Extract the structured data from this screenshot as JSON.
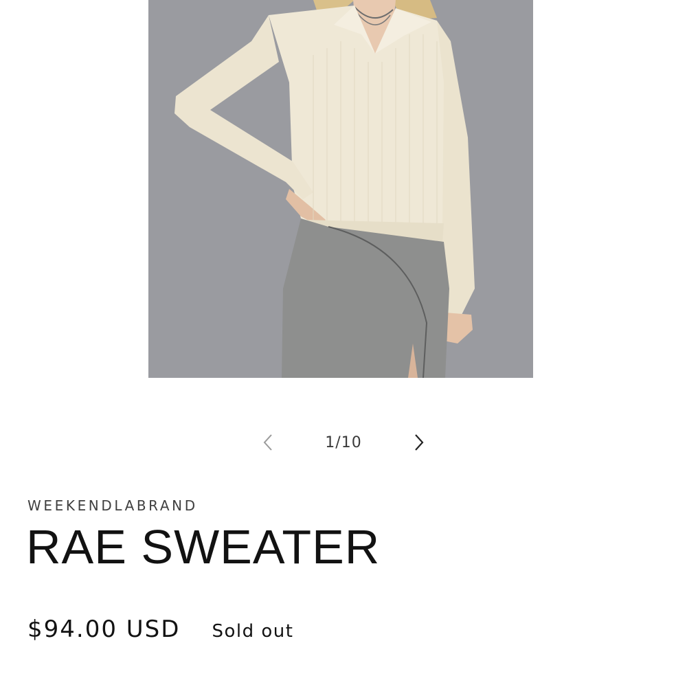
{
  "product": {
    "vendor": "WEEKENDLABRAND",
    "title": "RAE SWEATER",
    "price": "$94.00 USD",
    "availability": "Sold out"
  },
  "media": {
    "image_alt": "Model wearing cream ribbed v-neck collared sweater and grey midi skirt",
    "current": 1,
    "total": 10,
    "counter_label": "1/10"
  },
  "icons": {
    "previous": "chevron-left-icon",
    "next": "chevron-right-icon"
  },
  "colors": {
    "background": "#ffffff",
    "text": "#121212",
    "photo_backdrop": "#9b9ca0",
    "sweater": "#efe8d6",
    "skirt": "#8e8f8e",
    "chevron_inactive": "#9a9a9a",
    "chevron_active": "#222222"
  }
}
